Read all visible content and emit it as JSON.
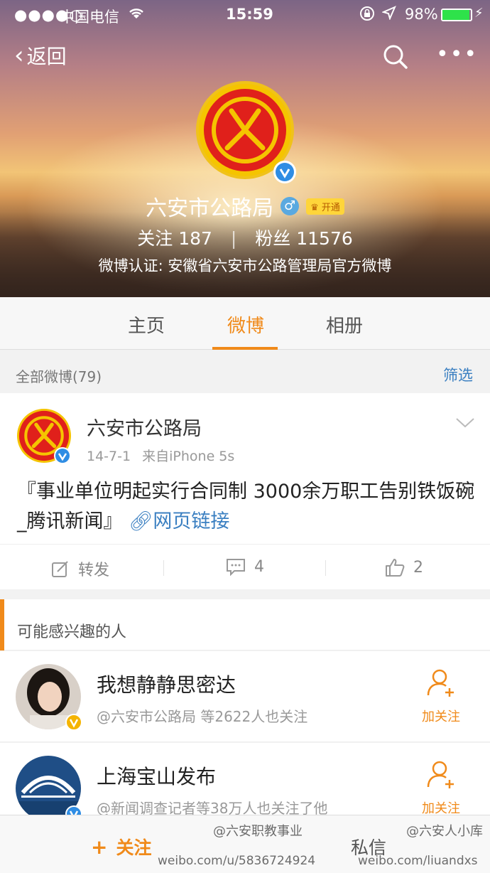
{
  "status_bar": {
    "signal": "●●●●○",
    "carrier": "中国电信",
    "time": "15:59",
    "battery": "98%"
  },
  "nav": {
    "back_label": "返回"
  },
  "profile": {
    "name": "六安市公路局",
    "vip_label": "开通",
    "following_label": "关注",
    "following_count": "187",
    "followers_label": "粉丝",
    "followers_count": "11576",
    "verification": "微博认证: 安徽省六安市公路管理局官方微博"
  },
  "tabs": [
    {
      "label": "主页"
    },
    {
      "label": "微博"
    },
    {
      "label": "相册"
    }
  ],
  "filter_bar": {
    "all_label": "全部微博(79)",
    "filter_label": "筛选"
  },
  "post": {
    "author": "六安市公路局",
    "date": "14-7-1",
    "source": "来自iPhone 5s",
    "text": "『事业单位明起实行合同制 3000余万职工告别铁饭碗_腾讯新闻』",
    "link_label": "网页链接",
    "repost_label": "转发",
    "comment_count": "4",
    "like_count": "2"
  },
  "suggestions": {
    "title": "可能感兴趣的人",
    "users": [
      {
        "name": "我想静静思密达",
        "reason": "@六安市公路局 等2622人也关注",
        "action": "加关注"
      },
      {
        "name": "上海宝山发布",
        "reason": "@新闻调查记者等38万人也关注了他",
        "action": "加关注"
      }
    ]
  },
  "bottom_bar": {
    "follow_label": "关注",
    "message_label": "私信"
  },
  "watermarks": {
    "wm1": "@六安职教事业",
    "wm2": "weibo.com/u/5836724924",
    "wm3": "@六安人小库",
    "wm4": "weibo.com/liuandxs"
  },
  "colors": {
    "accent": "#f08a1a",
    "link": "#3a7fc1",
    "logo_red": "#e0201b",
    "logo_yellow": "#f5c400",
    "battery_green": "#2ee24a"
  }
}
